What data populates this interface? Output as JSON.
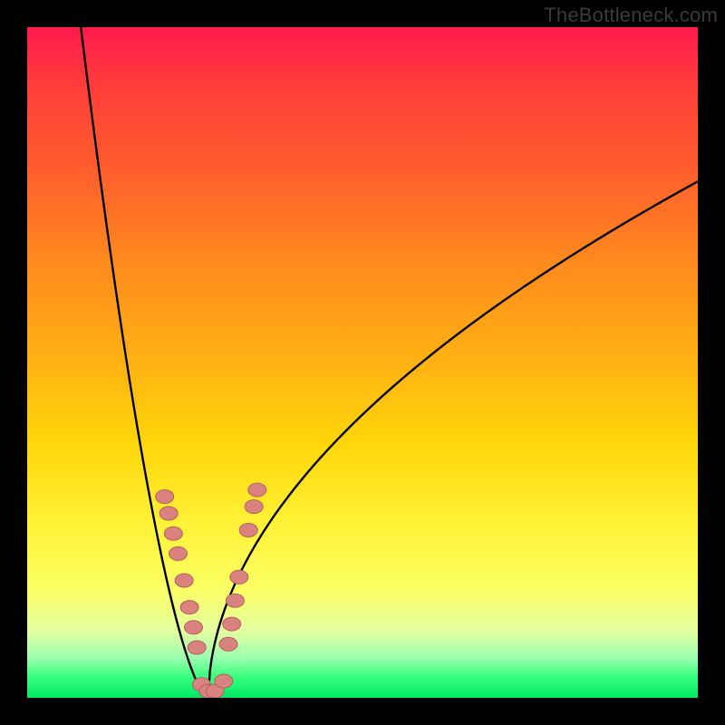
{
  "watermark": "TheBottleneck.com",
  "colors": {
    "frame": "#000000",
    "curve": "#000000",
    "marker_fill": "#d9827f",
    "marker_stroke": "#b55f5c"
  },
  "chart_data": {
    "type": "line",
    "title": "",
    "xlabel": "",
    "ylabel": "",
    "xlim": [
      0,
      100
    ],
    "ylim": [
      0,
      100
    ],
    "grid": false,
    "legend": false,
    "curve": {
      "description": "V-shaped bottleneck curve; minimum near x≈27",
      "minimum_x": 27,
      "left_start": {
        "x": 8,
        "y": 100
      },
      "right_end": {
        "x": 100,
        "y": 77
      }
    },
    "series": [
      {
        "name": "markers-left-branch",
        "points": [
          {
            "x": 20.5,
            "y": 30
          },
          {
            "x": 21.1,
            "y": 27.5
          },
          {
            "x": 21.8,
            "y": 24.5
          },
          {
            "x": 22.5,
            "y": 21.5
          },
          {
            "x": 23.4,
            "y": 17.5
          },
          {
            "x": 24.2,
            "y": 13.5
          },
          {
            "x": 24.8,
            "y": 10.5
          },
          {
            "x": 25.3,
            "y": 7.5
          }
        ]
      },
      {
        "name": "markers-bottom",
        "points": [
          {
            "x": 26.0,
            "y": 2.0
          },
          {
            "x": 27.0,
            "y": 1.0
          },
          {
            "x": 28.0,
            "y": 1.0
          },
          {
            "x": 29.3,
            "y": 2.5
          }
        ]
      },
      {
        "name": "markers-right-branch",
        "points": [
          {
            "x": 30.0,
            "y": 8.0
          },
          {
            "x": 30.5,
            "y": 11.0
          },
          {
            "x": 31.0,
            "y": 14.5
          },
          {
            "x": 31.6,
            "y": 18.0
          },
          {
            "x": 33.0,
            "y": 25.0
          },
          {
            "x": 33.8,
            "y": 28.5
          },
          {
            "x": 34.3,
            "y": 31.0
          }
        ]
      }
    ]
  }
}
